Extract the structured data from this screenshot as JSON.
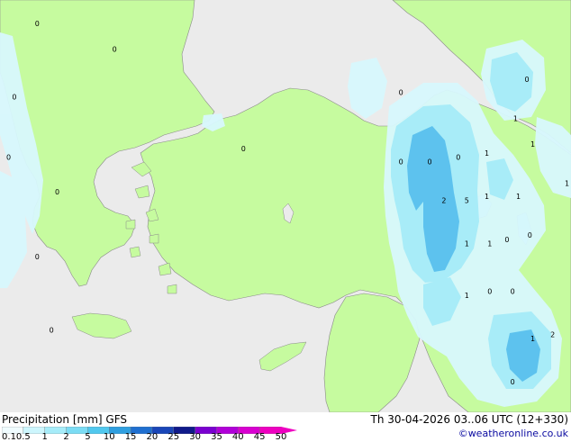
{
  "title": {
    "variable": "Precipitation [mm]",
    "model": "GFS",
    "valid": "Th 30-04-2026 03..06 UTC (12+330)"
  },
  "credit": "©weatheronline.co.uk",
  "colorbar": {
    "ticks": [
      "0.1",
      "0.5",
      "1",
      "2",
      "5",
      "10",
      "15",
      "20",
      "25",
      "30",
      "35",
      "40",
      "45",
      "50"
    ],
    "colors": [
      "#f0fcff",
      "#cdf6fd",
      "#a6ecf9",
      "#7bdcf4",
      "#51c8ee",
      "#2f9fe0",
      "#1f6fd0",
      "#1a46b8",
      "#101a8a",
      "#7a00d0",
      "#b000d8",
      "#d800d0",
      "#ee00c0"
    ]
  },
  "colors": {
    "land": "#c6fb9f",
    "sea": "#ebebeb",
    "precip_light": "#d8f8fd",
    "precip_medium": "#a8ecf8",
    "precip_heavy": "#5dc2ee",
    "border": "#808080"
  },
  "map_labels": [
    {
      "text": "0",
      "lon": 19.3,
      "lat": 43.9
    },
    {
      "text": "0",
      "lon": 22.0,
      "lat": 43.3
    },
    {
      "text": "0",
      "lon": 18.5,
      "lat": 42.2
    },
    {
      "text": "0",
      "lon": 18.3,
      "lat": 40.8
    },
    {
      "text": "0",
      "lon": 20.0,
      "lat": 40.0
    },
    {
      "text": "0",
      "lon": 19.3,
      "lat": 38.5
    },
    {
      "text": "0",
      "lon": 19.8,
      "lat": 36.8
    },
    {
      "text": "0",
      "lon": 32.0,
      "lat": 42.3
    },
    {
      "text": "0",
      "lon": 26.5,
      "lat": 41.0
    },
    {
      "text": "0",
      "lon": 32.0,
      "lat": 40.7
    },
    {
      "text": "0",
      "lon": 33.0,
      "lat": 40.7
    },
    {
      "text": "0",
      "lon": 34.0,
      "lat": 40.8
    },
    {
      "text": "1",
      "lon": 35.0,
      "lat": 40.9
    },
    {
      "text": "2",
      "lon": 33.5,
      "lat": 39.8
    },
    {
      "text": "5",
      "lon": 34.3,
      "lat": 39.8
    },
    {
      "text": "1",
      "lon": 35.0,
      "lat": 39.9
    },
    {
      "text": "1",
      "lon": 36.1,
      "lat": 39.9
    },
    {
      "text": "1",
      "lon": 34.3,
      "lat": 38.8
    },
    {
      "text": "1",
      "lon": 35.1,
      "lat": 38.8
    },
    {
      "text": "0",
      "lon": 35.7,
      "lat": 38.9
    },
    {
      "text": "0",
      "lon": 36.5,
      "lat": 39.0
    },
    {
      "text": "1",
      "lon": 34.3,
      "lat": 37.6
    },
    {
      "text": "0",
      "lon": 35.1,
      "lat": 37.7
    },
    {
      "text": "0",
      "lon": 35.9,
      "lat": 37.7
    },
    {
      "text": "1",
      "lon": 36.6,
      "lat": 36.6
    },
    {
      "text": "2",
      "lon": 37.3,
      "lat": 36.7
    },
    {
      "text": "0",
      "lon": 35.9,
      "lat": 35.6
    },
    {
      "text": "0",
      "lon": 36.4,
      "lat": 42.6
    },
    {
      "text": "1",
      "lon": 36.0,
      "lat": 41.7
    },
    {
      "text": "1",
      "lon": 36.6,
      "lat": 41.1
    },
    {
      "text": "1",
      "lon": 37.8,
      "lat": 40.2
    }
  ]
}
